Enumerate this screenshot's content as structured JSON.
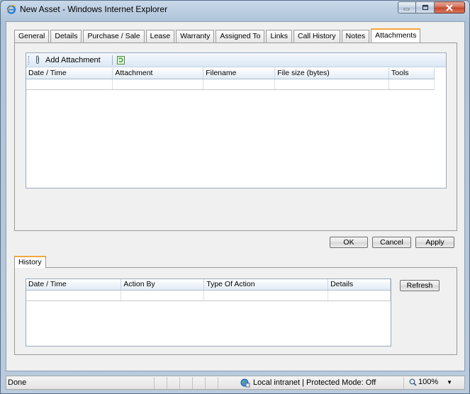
{
  "window": {
    "title": "New Asset - Windows Internet Explorer",
    "min_icon": "minimize-icon",
    "max_icon": "maximize-icon",
    "close_icon": "close-icon"
  },
  "tabs": [
    {
      "label": "General"
    },
    {
      "label": "Details"
    },
    {
      "label": "Purchase / Sale"
    },
    {
      "label": "Lease"
    },
    {
      "label": "Warranty"
    },
    {
      "label": "Assigned To"
    },
    {
      "label": "Links"
    },
    {
      "label": "Call History"
    },
    {
      "label": "Notes"
    },
    {
      "label": "Attachments",
      "active": true
    }
  ],
  "attachments": {
    "toolbar": {
      "add_label": "Add Attachment",
      "add_icon": "paperclip-icon",
      "refresh_icon": "refresh-icon"
    },
    "columns": [
      "Date / Time",
      "Attachment",
      "Filename",
      "File size (bytes)",
      "Tools"
    ]
  },
  "actions": {
    "ok": "OK",
    "cancel": "Cancel",
    "apply": "Apply"
  },
  "history": {
    "tab_label": "History",
    "columns": [
      "Date / Time",
      "Action By",
      "Type Of Action",
      "Details"
    ],
    "refresh": "Refresh"
  },
  "status": {
    "text": "Done",
    "zone": "Local intranet | Protected Mode: Off",
    "zone_icon": "globe-icon",
    "zoom": "100%",
    "zoom_icon": "magnifier-icon"
  },
  "colors": {
    "active_tab_accent": "#f2a73b",
    "grid_header": "#e2ebf5"
  }
}
